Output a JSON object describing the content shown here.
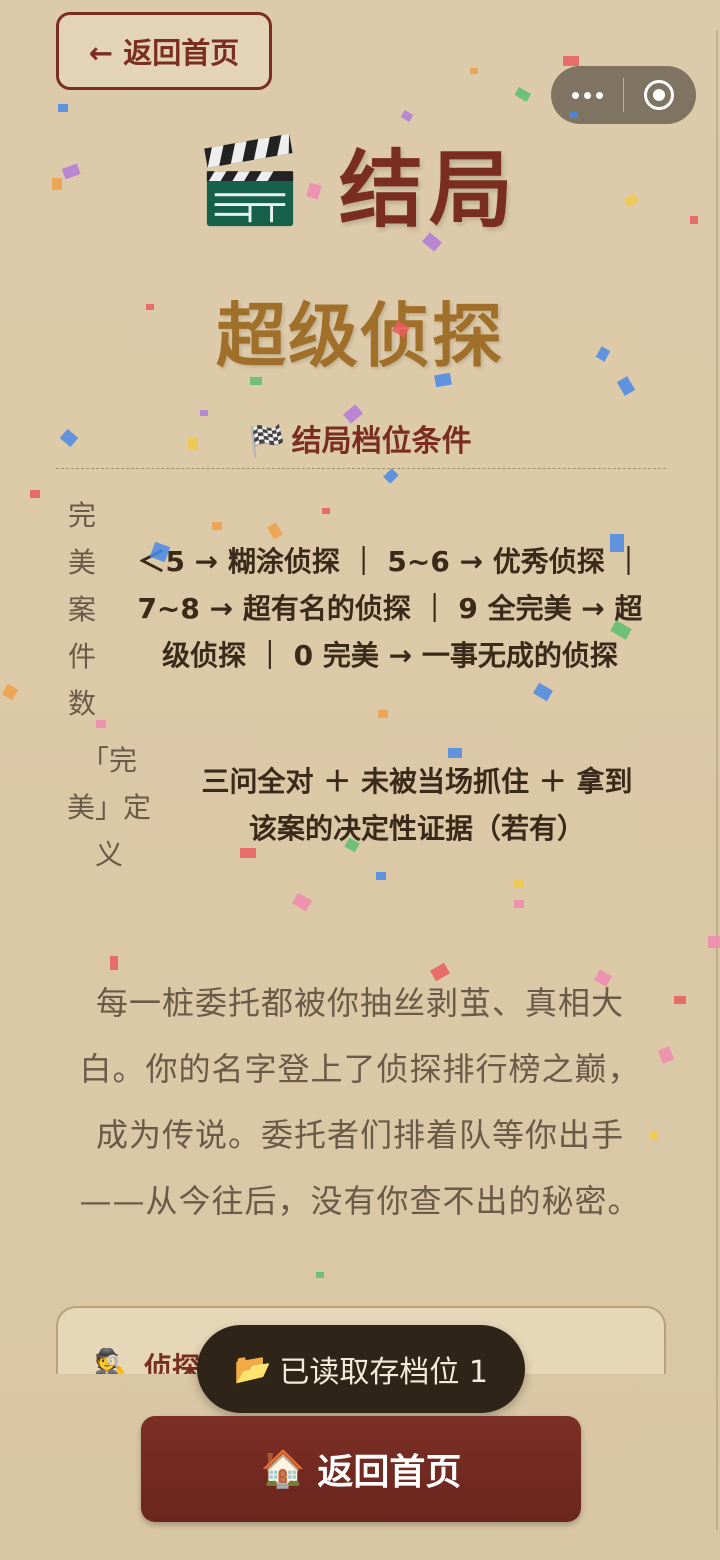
{
  "header": {
    "back_label": "← 返回首页",
    "capsule_more": "more-icon",
    "capsule_close": "target-icon"
  },
  "title": {
    "icon": "🎬",
    "text": "结局"
  },
  "ending": {
    "rank": "超级侦探"
  },
  "conditions": {
    "title": "结局档位条件",
    "flag_icon": "🏁",
    "rows": [
      {
        "label": "完美案件数",
        "text_lines": [
          "＜5 → 糊涂侦探 ｜ 5~6 → 优秀侦探 ｜",
          "7~8 → 超有名的侦探 ｜ 9 全完美 → 超",
          "级侦探 ｜ 0 完美 → 一事无成的侦探"
        ]
      },
      {
        "label_lines": [
          "「完",
          "美」定",
          "义"
        ],
        "text_lines": [
          "三问全对 ＋ 未被当场抓住 ＋ 拿到",
          "该案的决定性证据（若有）"
        ]
      }
    ]
  },
  "story": {
    "lines": [
      "每一桩委托都被你抽丝剥茧、真相大",
      "白。你的名字登上了侦探排行榜之巅，",
      "成为传说。委托者们排着队等你出手",
      "——从今往后，没有你查不出的秘密。"
    ]
  },
  "archive": {
    "icon": "🕵️",
    "label": "侦探档案"
  },
  "toast": {
    "icon": "📂",
    "text": "已读取存档位 1"
  },
  "home_button": {
    "icon": "🏠",
    "label": "返回首页"
  },
  "colors": {
    "accent": "#7a2e22",
    "rank": "#a0702a",
    "background": "#dccbab",
    "toast": "#2e2418"
  }
}
